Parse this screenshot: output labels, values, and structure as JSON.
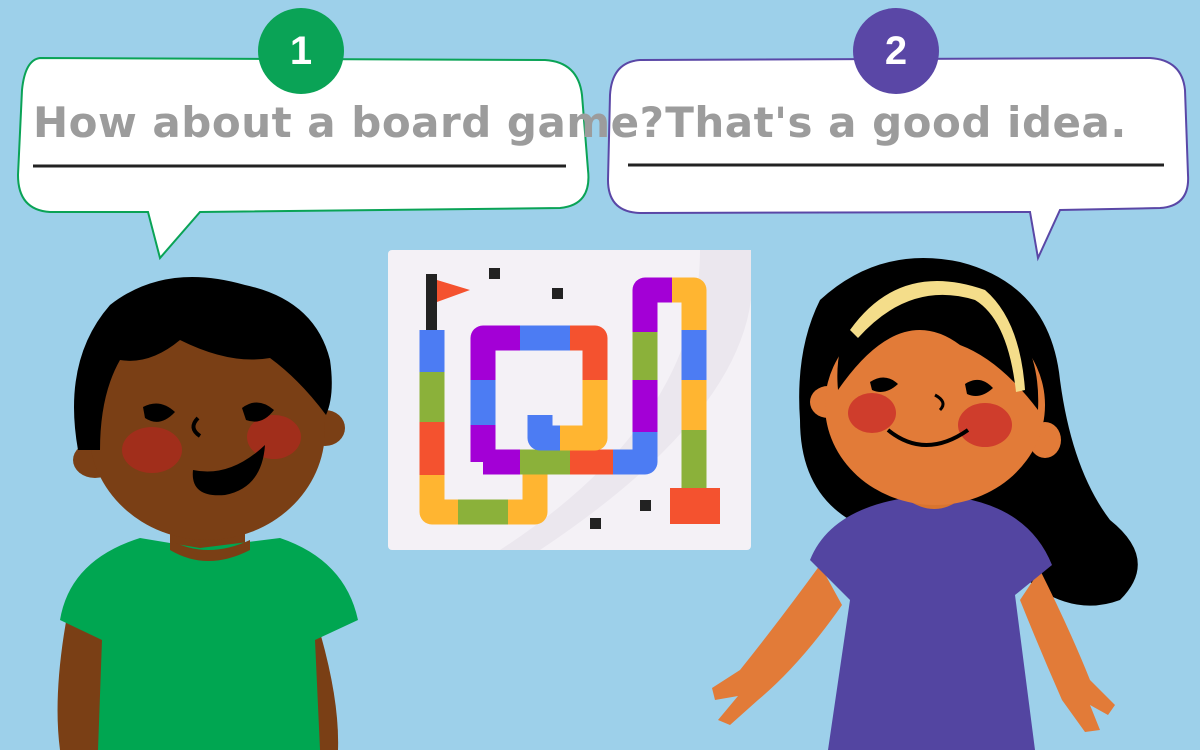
{
  "bubbles": [
    {
      "number": "1",
      "text": "How about a board game?",
      "color": "#0aa356"
    },
    {
      "number": "2",
      "text": "That's a good idea.",
      "color": "#5a47a6"
    }
  ],
  "icons": [
    "board-game-icon",
    "flag-icon"
  ],
  "colors": {
    "background": "#9dd0ea",
    "boy_shirt": "#00a651",
    "girl_dress": "#5345a1",
    "board_path": [
      "#4c7cf3",
      "#8bb13a",
      "#f4522f",
      "#ffb531",
      "#a300d6"
    ]
  }
}
